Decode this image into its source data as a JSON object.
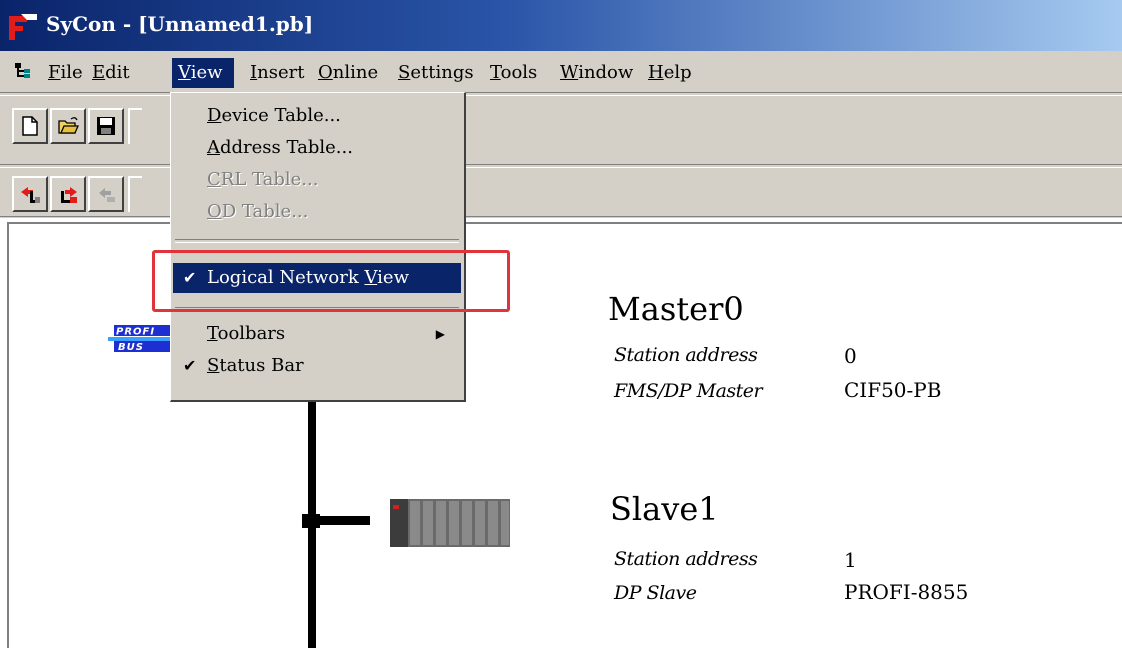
{
  "window": {
    "title": "SyCon - [Unnamed1.pb]"
  },
  "menubar": {
    "items": [
      {
        "label": "File",
        "active": false
      },
      {
        "label": "Edit",
        "active": false
      },
      {
        "label": "View",
        "active": true
      },
      {
        "label": "Insert",
        "active": false
      },
      {
        "label": "Online",
        "active": false
      },
      {
        "label": "Settings",
        "active": false
      },
      {
        "label": "Tools",
        "active": false
      },
      {
        "label": "Window",
        "active": false
      },
      {
        "label": "Help",
        "active": false
      }
    ]
  },
  "view_menu": {
    "items": [
      {
        "label": "Device Table...",
        "enabled": true
      },
      {
        "label": "Address Table...",
        "enabled": true
      },
      {
        "label": "CRL Table...",
        "enabled": false
      },
      {
        "label": "OD Table...",
        "enabled": false
      },
      {
        "label": "Logical Network View",
        "enabled": true,
        "checked": true,
        "selected": true
      },
      {
        "label": "Toolbars",
        "enabled": true,
        "submenu": true
      },
      {
        "label": "Status Bar",
        "enabled": true,
        "checked": true
      }
    ]
  },
  "toolbar": {
    "buttons": [
      "new-icon",
      "open-folder-icon",
      "save-icon",
      "insert-master-icon",
      "insert-slave-icon",
      "disabled-tool-icon"
    ]
  },
  "network": {
    "master": {
      "name": "Master0",
      "station_label": "Station address",
      "station_value": "0",
      "type_label": "FMS/DP Master",
      "type_value": "CIF50-PB"
    },
    "slave": {
      "name": "Slave1",
      "station_label": "Station address",
      "station_value": "1",
      "type_label": "DP Slave",
      "type_value": "PROFI-8855"
    }
  },
  "colors": {
    "title_gradient_start": "#0a246a",
    "title_gradient_end": "#a6caf0",
    "menu_highlight": "#0a246a",
    "annotation_box": "#e0333a",
    "chrome": "#d4d0c8"
  }
}
